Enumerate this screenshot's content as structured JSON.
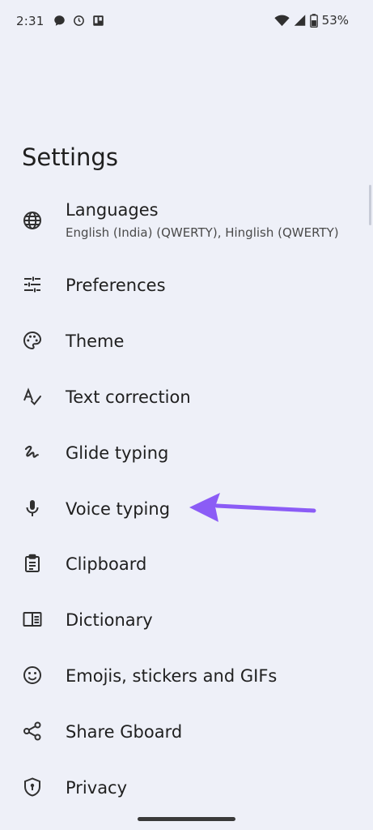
{
  "status_bar": {
    "time": "2:31",
    "left_icons": [
      "chat-bubble-icon",
      "refresh-clock-icon",
      "trello-board-icon"
    ],
    "right_icons": [
      "wifi-icon",
      "cellular-signal-icon",
      "battery-icon"
    ],
    "battery_percent": "53%"
  },
  "page": {
    "title": "Settings"
  },
  "settings": {
    "items": [
      {
        "label": "Languages",
        "subtitle": "English (India) (QWERTY), Hinglish (QWERTY)",
        "icon": "globe-icon"
      },
      {
        "label": "Preferences",
        "icon": "sliders-icon"
      },
      {
        "label": "Theme",
        "icon": "palette-icon"
      },
      {
        "label": "Text correction",
        "icon": "text-check-icon"
      },
      {
        "label": "Glide typing",
        "icon": "glide-squiggle-icon"
      },
      {
        "label": "Voice typing",
        "icon": "microphone-icon"
      },
      {
        "label": "Clipboard",
        "icon": "clipboard-icon"
      },
      {
        "label": "Dictionary",
        "icon": "book-icon"
      },
      {
        "label": "Emojis, stickers and GIFs",
        "icon": "smiley-icon"
      },
      {
        "label": "Share Gboard",
        "icon": "share-icon"
      },
      {
        "label": "Privacy",
        "icon": "shield-icon"
      }
    ]
  },
  "colors": {
    "background": "#eef0f8",
    "text_primary": "#1f1f1f",
    "icon": "#303030",
    "annotation_arrow": "#8b5cf6"
  }
}
